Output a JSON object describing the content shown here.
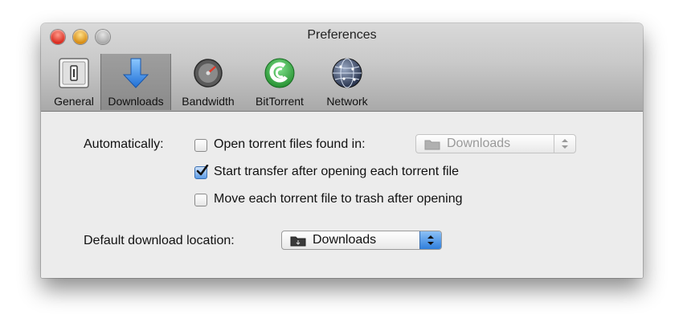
{
  "window": {
    "title": "Preferences"
  },
  "toolbar": {
    "tabs": [
      {
        "label": "General",
        "icon": "general-switch-icon",
        "selected": false
      },
      {
        "label": "Downloads",
        "icon": "download-arrow-icon",
        "selected": true
      },
      {
        "label": "Bandwidth",
        "icon": "gauge-icon",
        "selected": false
      },
      {
        "label": "BitTorrent",
        "icon": "bittorrent-icon",
        "selected": false
      },
      {
        "label": "Network",
        "icon": "globe-icon",
        "selected": false
      }
    ]
  },
  "downloads": {
    "automatically_label": "Automatically:",
    "open_torrent": {
      "label": "Open torrent files found in:",
      "checked": false
    },
    "watch_folder": {
      "value": "Downloads",
      "enabled": false
    },
    "start_transfer": {
      "label": "Start transfer after opening each torrent file",
      "checked": true
    },
    "move_to_trash": {
      "label": "Move each torrent file to trash after opening",
      "checked": false
    },
    "default_location_label": "Default download location:",
    "default_location": {
      "value": "Downloads",
      "enabled": true
    }
  },
  "colors": {
    "accent_blue": "#2f7fdc",
    "bittorrent_green": "#2fa83a"
  }
}
